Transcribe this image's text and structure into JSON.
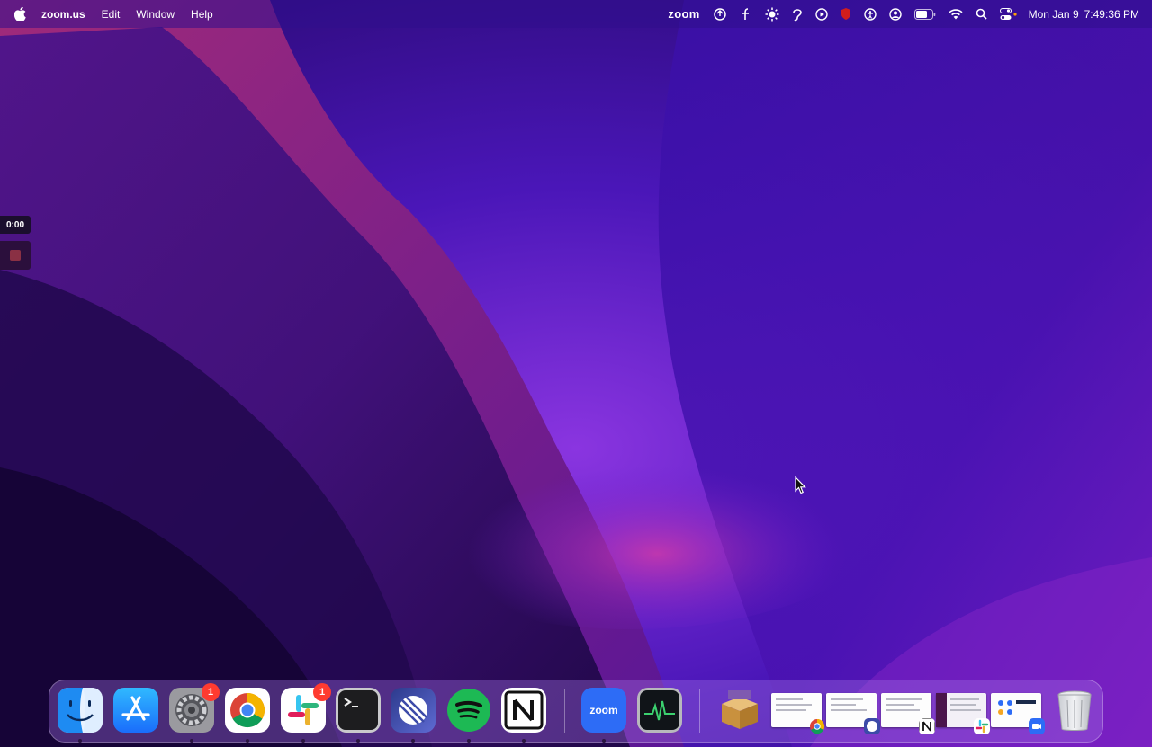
{
  "menubar": {
    "app_name": "zoom.us",
    "menus": [
      "Edit",
      "Window",
      "Help"
    ],
    "status_zoom": "zoom",
    "clock_date": "Mon Jan 9",
    "clock_time": "7:49:36 PM",
    "status_icons": [
      "zoom-menu-icon",
      "touch-icon",
      "font-icon",
      "brightness-icon",
      "hearing-icon",
      "play-icon",
      "shield-icon",
      "accessibility-icon",
      "user-icon",
      "battery-icon",
      "wifi-icon",
      "search-icon",
      "control-center-icon"
    ]
  },
  "recorder": {
    "time": "0:00"
  },
  "dock": {
    "apps": [
      {
        "name": "Finder",
        "icon": "finder-icon",
        "running": true
      },
      {
        "name": "App Store",
        "icon": "app-store-icon",
        "running": false
      },
      {
        "name": "System Preferences",
        "icon": "settings-icon",
        "badge": "1",
        "running": true
      },
      {
        "name": "Google Chrome",
        "icon": "chrome-icon",
        "running": true
      },
      {
        "name": "Slack",
        "icon": "slack-icon",
        "badge": "1",
        "running": true
      },
      {
        "name": "Terminal",
        "icon": "terminal-icon",
        "running": true
      },
      {
        "name": "Linear",
        "icon": "linear-icon",
        "running": true
      },
      {
        "name": "Spotify",
        "icon": "spotify-icon",
        "running": true
      },
      {
        "name": "Notion",
        "icon": "notion-icon",
        "running": true
      },
      {
        "name": "zoom.us",
        "icon": "zoom-icon",
        "label": "zoom",
        "running": true
      },
      {
        "name": "Activity Monitor",
        "icon": "activity-monitor-icon",
        "running": false
      }
    ],
    "minimized": [
      {
        "icon": "installer-icon"
      },
      {
        "icon": "chrome-window-thumbnail"
      },
      {
        "icon": "linear-window-thumbnail"
      },
      {
        "icon": "notion-window-thumbnail"
      },
      {
        "icon": "slack-window-thumbnail"
      },
      {
        "icon": "zoom-window-thumbnail"
      }
    ],
    "trash": {
      "icon": "trash-icon"
    },
    "badge_color": "#ff3b30"
  },
  "colors": {
    "accent": "#6a1fd0",
    "wallpaper_base": "#2a0a6e"
  }
}
